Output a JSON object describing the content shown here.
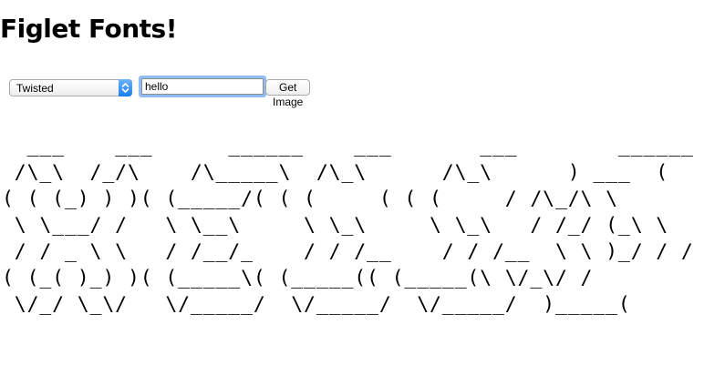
{
  "page": {
    "title": "Figlet Fonts!"
  },
  "controls": {
    "font_select": {
      "selected": "Twisted"
    },
    "text_input": {
      "value": "hello"
    },
    "submit_label": "Get Image"
  },
  "ascii_output": {
    "text": "  ___    ___      ______    ___       ___        ______  \n /\\_\\  /_/\\    /\\_____\\  /\\_\\      /\\_\\      ) ___  ( \n( ( (_) ) )( (_____/( ( (     ( ( (     / /\\_/\\ \\\n \\ \\___/ /   \\ \\__\\     \\ \\_\\     \\ \\_\\   / /_/ (_\\ \\\n / / _ \\ \\   / /__/_    / / /__    / / /__  \\ \\ )_/ / /\n( (_( )_) )( (_____\\( (_____(( (_____(\\ \\/_\\/ / \n \\/_/ \\_\\/   \\/_____/  \\/_____/  \\/_____/  )_____( "
  },
  "theme": {
    "focus_ring": "#8fbdf4",
    "select_arrow": "#1a7ef2"
  }
}
